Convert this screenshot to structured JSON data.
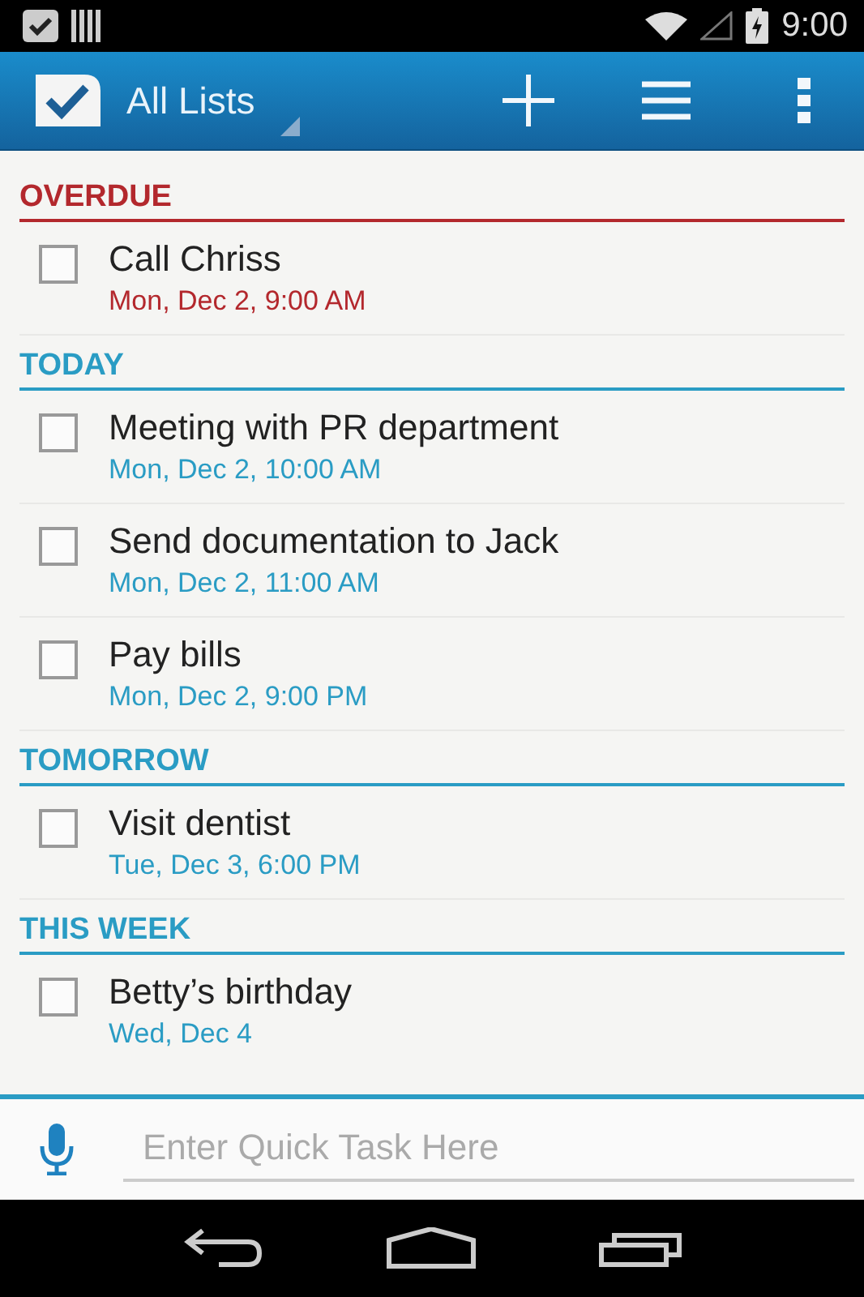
{
  "status_bar": {
    "time": "9:00"
  },
  "app_bar": {
    "title": "All Lists"
  },
  "sections": [
    {
      "title": "OVERDUE",
      "color": "#b3282d",
      "tasks": [
        {
          "title": "Call Chriss",
          "due": "Mon, Dec 2, 9:00 AM",
          "checked": false
        }
      ]
    },
    {
      "title": "TODAY",
      "color": "#2a9cc4",
      "tasks": [
        {
          "title": "Meeting with PR  department",
          "due": "Mon, Dec 2, 10:00 AM",
          "checked": false
        },
        {
          "title": "Send documentation to Jack",
          "due": "Mon, Dec 2, 11:00 AM",
          "checked": false
        },
        {
          "title": "Pay bills",
          "due": "Mon, Dec 2, 9:00 PM",
          "checked": false
        }
      ]
    },
    {
      "title": "TOMORROW",
      "color": "#2a9cc4",
      "tasks": [
        {
          "title": "Visit dentist",
          "due": "Tue, Dec 3, 6:00 PM",
          "checked": false
        }
      ]
    },
    {
      "title": "THIS WEEK",
      "color": "#2a9cc4",
      "tasks": [
        {
          "title": "Betty’s birthday",
          "due": "Wed, Dec 4",
          "checked": false
        }
      ]
    }
  ],
  "quick_task": {
    "placeholder": "Enter Quick Task Here"
  }
}
